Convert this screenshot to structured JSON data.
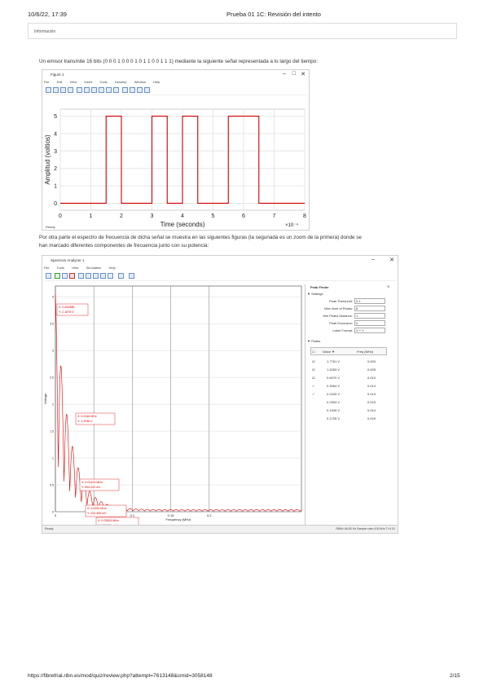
{
  "header": {
    "datetime": "10/6/22, 17:39",
    "title": "Prueba 01 1C: Revisión del intento"
  },
  "info_box": {
    "label": "Información"
  },
  "question": {
    "paragraph1": "Un emisor transmite 16 bits (0 0 0 1 0 0 0 1 0 1 1 0 0 1 1 1) mediante la siguiente señal representada a lo largo del tiempo:",
    "paragraph2_line1": "Por otra parte el espectro de frecuencia de dicha señal se muestra en las siguientes figuras (la segunada es un zoom de la primera) donde se",
    "paragraph2_line2": "han marcado diferentes componentes de frecuencia junto con su potencia:"
  },
  "signal_window": {
    "title": "Figure 1",
    "menu": [
      "File",
      "Edit",
      "View",
      "Insert",
      "Tools",
      "Desktop",
      "Window",
      "Help"
    ],
    "status": "Ready",
    "x_multiplier": "×10⁻⁴"
  },
  "chart_data": [
    {
      "type": "line",
      "title": "",
      "xlabel": "Time (seconds)",
      "ylabel": "Amplitud (voltios)",
      "xlim": [
        0,
        8
      ],
      "ylim": [
        0,
        5
      ],
      "x_ticks": [
        "0",
        "1",
        "2",
        "3",
        "4",
        "5",
        "6",
        "7",
        "8"
      ],
      "y_ticks": [
        "0",
        "1",
        "2",
        "3",
        "4",
        "5"
      ],
      "x_scale_label": "×10⁻⁴",
      "grid": true,
      "series": [
        {
          "color": "#cc0000",
          "x": [
            0,
            1.5,
            1.5,
            2.0,
            2.0,
            3.0,
            3.0,
            3.5,
            3.5,
            4.0,
            4.0,
            4.5,
            4.5,
            5.5,
            5.5,
            6.5,
            6.5,
            8.0
          ],
          "y": [
            0,
            0,
            5,
            5,
            0,
            0,
            5,
            5,
            0,
            0,
            5,
            5,
            0,
            0,
            5,
            5,
            0,
            0
          ]
        }
      ]
    },
    {
      "type": "line",
      "title": "",
      "xlabel": "Frequency (MHz)",
      "ylabel": "Voltage",
      "xlim": [
        0,
        0.32
      ],
      "x_ticks": [
        "0",
        "0.05",
        "0.1",
        "0.15",
        "0.2"
      ],
      "y_ticks": [
        "0",
        "0.5",
        "1",
        "1.5",
        "2",
        "2.5",
        "3",
        "3.5",
        "4"
      ],
      "grid": true,
      "annotations": [
        {
          "line1": "X: 0.000488",
          "line2": "Y: 2.1875 V"
        },
        {
          "line1": "X: 0.0146 MHz",
          "line2": "Y: 1.2046 V"
        },
        {
          "line1": "X: 0.01424 MHz",
          "line2": "Y: 504.202 mV"
        },
        {
          "line1": "X: 0.0253 MHz",
          "line2": "Y: 233.455 mV"
        },
        {
          "line1": "X: 0.03834 MHz",
          "line2": "Y: 107.056 mV"
        }
      ]
    }
  ],
  "spectrum_window": {
    "title": "Spectrum Analyzer 1",
    "menu": [
      "File",
      "Tools",
      "View",
      "Simulation",
      "Help"
    ],
    "peak_finder_title": "Peak Finder",
    "settings_label": "Settings",
    "settings": [
      {
        "label": "Peak Threshold:",
        "value": "0.1"
      },
      {
        "label": "Max Num of Peaks:",
        "value": "8"
      },
      {
        "label": "Min Peaks Distance:",
        "value": "1"
      },
      {
        "label": "Peak Excursion:",
        "value": "0"
      },
      {
        "label": "Label Format:",
        "value": "X + Y"
      }
    ],
    "peaks_label": "Peaks",
    "peaks_col1": "Value ▼",
    "peaks_col2": "Freq (MHz)",
    "peaks": [
      {
        "check": "☑",
        "value": "1.7761 V",
        "freq": "0.000"
      },
      {
        "check": "☑",
        "value": "1.2053 V",
        "freq": "0.005"
      },
      {
        "check": "☑",
        "value": "0.6970 V",
        "freq": "0.010"
      },
      {
        "check": "✓",
        "value": "0.3064 V",
        "freq": "0.014"
      },
      {
        "check": "✓",
        "value": "0.2433 V",
        "freq": "0.019"
      },
      {
        "check": "",
        "value": "0.2303 V",
        "freq": "0.023"
      },
      {
        "check": "",
        "value": "0.1939 V",
        "freq": "0.024"
      },
      {
        "check": "",
        "value": "0.1705 V",
        "freq": "0.029"
      }
    ],
    "status_left": "Ready",
    "status_right": "RBW=48.83 Hz   Sample rate=100 kHz   T=0.01"
  },
  "footer": {
    "url": "https://fibrefrial.ribn.es/mod/quiz/review.php?attempt=7613148&cmid=3058148",
    "page": "2/15"
  }
}
